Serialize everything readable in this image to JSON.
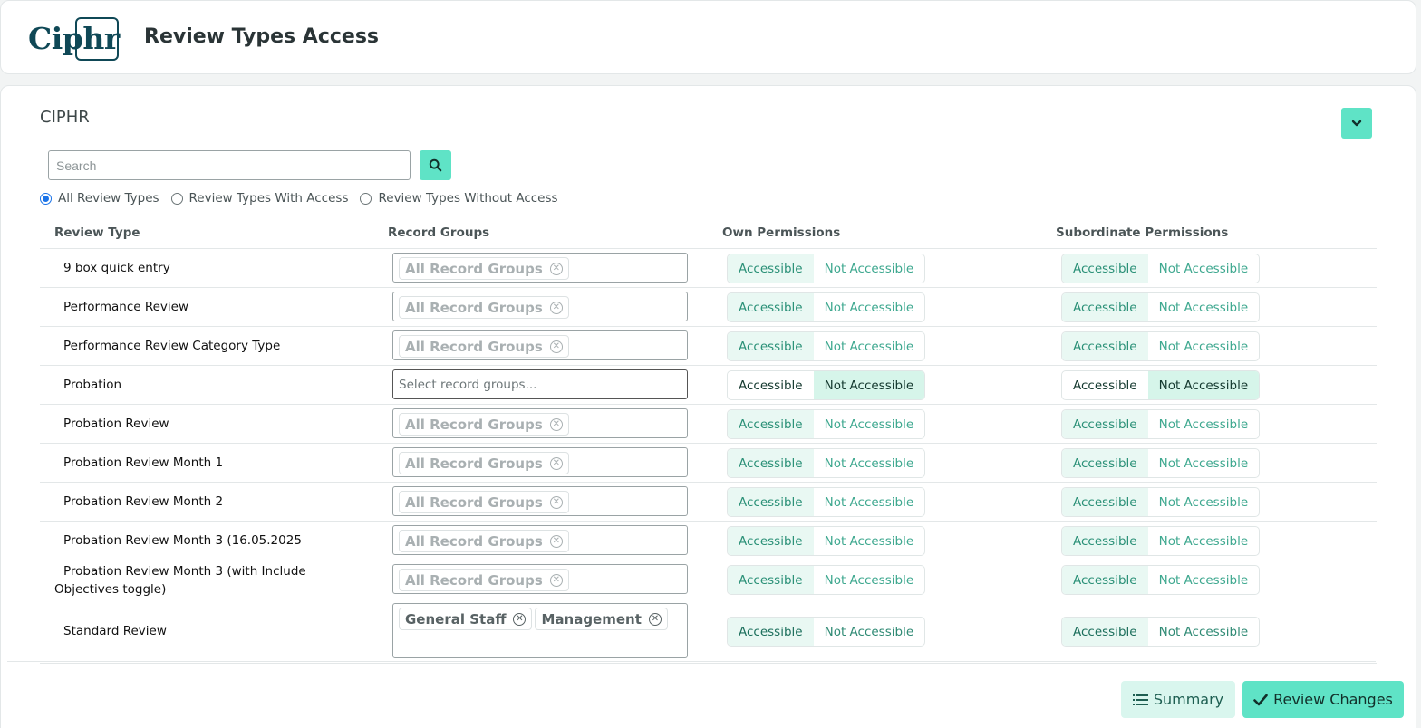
{
  "header": {
    "logo_text": "Ciphr",
    "title": "Review Types Access"
  },
  "panel": {
    "org_name": "CIPHR",
    "search": {
      "placeholder": "Search",
      "value": ""
    },
    "filters": [
      {
        "label": "All Review Types",
        "checked": true
      },
      {
        "label": "Review Types With Access",
        "checked": false
      },
      {
        "label": "Review Types Without Access",
        "checked": false
      }
    ],
    "columns": {
      "review_type": "Review Type",
      "record_groups": "Record Groups",
      "own": "Own Permissions",
      "subordinate": "Subordinate Permissions"
    },
    "toggle_labels": {
      "accessible": "Accessible",
      "not_accessible": "Not Accessible"
    },
    "rows": [
      {
        "name": "9 box quick entry",
        "groups": [
          "All Record Groups"
        ],
        "own": "Accessible",
        "sub": "Accessible"
      },
      {
        "name": "Performance Review",
        "groups": [
          "All Record Groups"
        ],
        "own": "Accessible",
        "sub": "Accessible"
      },
      {
        "name": "Performance Review Category Type",
        "groups": [
          "All Record Groups"
        ],
        "own": "Accessible",
        "sub": "Accessible"
      },
      {
        "name": "Probation",
        "groups": [],
        "placeholder": "Select record groups...",
        "own": "Not Accessible",
        "sub": "Not Accessible"
      },
      {
        "name": "Probation Review",
        "groups": [
          "All Record Groups"
        ],
        "own": "Accessible",
        "sub": "Accessible"
      },
      {
        "name": "Probation Review Month 1",
        "groups": [
          "All Record Groups"
        ],
        "own": "Accessible",
        "sub": "Accessible"
      },
      {
        "name": "Probation Review Month 2",
        "groups": [
          "All Record Groups"
        ],
        "own": "Accessible",
        "sub": "Accessible"
      },
      {
        "name": "Probation Review Month 3 (16.05.2025",
        "groups": [
          "All Record Groups"
        ],
        "own": "Accessible",
        "sub": "Accessible"
      },
      {
        "name": "Probation Review Month 3 (with Include Objectives toggle)",
        "groups": [
          "All Record Groups"
        ],
        "own": "Accessible",
        "sub": "Accessible"
      },
      {
        "name": "Standard Review",
        "groups": [
          "General Staff",
          "Management"
        ],
        "own": "Accessible",
        "sub": "Accessible"
      }
    ]
  },
  "footer": {
    "summary_label": "Summary",
    "review_label": "Review Changes"
  },
  "colors": {
    "accent": "#5fe3c6",
    "brand": "#0f4856",
    "selected_segment": "#e9f8f3"
  },
  "icons": {
    "search": "search-icon",
    "collapse": "chevron-down-icon",
    "summary": "list-icon",
    "review": "check-icon",
    "chip_remove": "circle-x-icon"
  }
}
